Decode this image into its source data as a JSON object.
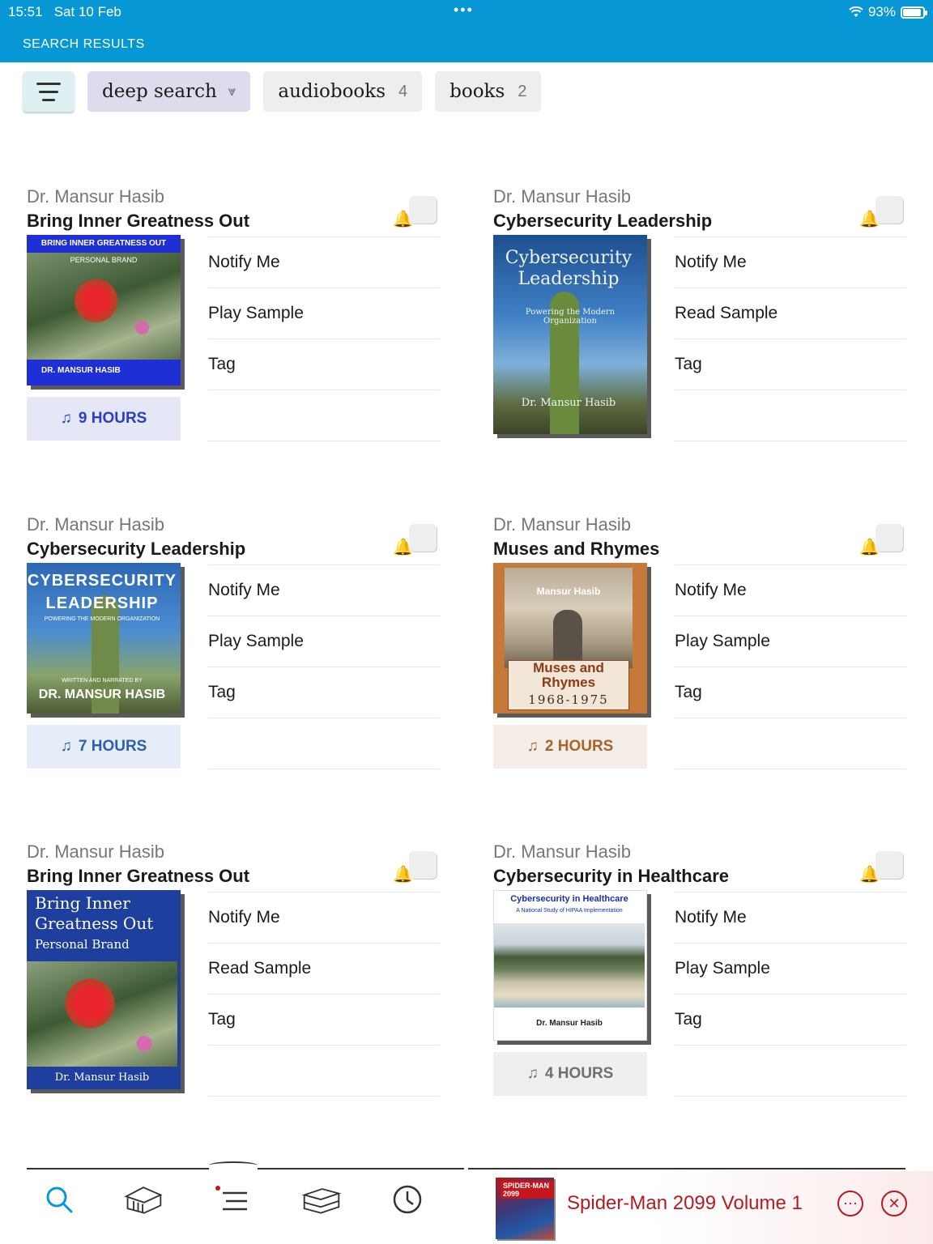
{
  "status_bar": {
    "time": "15:51",
    "date": "Sat 10 Feb",
    "battery": "93%"
  },
  "header": {
    "title": "SEARCH RESULTS"
  },
  "filters": [
    {
      "label": "deep search",
      "count": ""
    },
    {
      "label": "audiobooks",
      "count": "4"
    },
    {
      "label": "books",
      "count": "2"
    }
  ],
  "results": [
    {
      "author": "Dr. Mansur Hasib",
      "title": "Bring Inner Greatness Out",
      "cover_text": [
        "BRING INNER GREATNESS OUT",
        "PERSONAL BRAND",
        "DR. MANSUR HASIB"
      ],
      "hours": "9 HOURS",
      "hours_color": "#2a3fc1",
      "hours_bg": "#e5e7f7",
      "actions": [
        "Notify Me",
        "Play Sample",
        "Tag"
      ]
    },
    {
      "author": "Dr. Mansur Hasib",
      "title": "Cybersecurity Leadership",
      "cover_text": [
        "Cybersecurity",
        "Leadership",
        "Powering the Modern Organization",
        "Dr. Mansur Hasib"
      ],
      "hours": "",
      "actions": [
        "Notify Me",
        "Read Sample",
        "Tag"
      ]
    },
    {
      "author": "Dr. Mansur Hasib",
      "title": "Cybersecurity Leadership",
      "cover_text": [
        "CYBERSECURITY",
        "LEADERSHIP",
        "POWERING THE MODERN ORGANIZATION",
        "WRITTEN AND NARRATED BY",
        "DR. MANSUR HASIB"
      ],
      "hours": "7 HOURS",
      "hours_color": "#2f5fa8",
      "hours_bg": "#e6edf6",
      "actions": [
        "Notify Me",
        "Play Sample",
        "Tag"
      ]
    },
    {
      "author": "Dr. Mansur Hasib",
      "title": "Muses and Rhymes",
      "cover_text": [
        "Mansur Hasib",
        "Muses and",
        "Rhymes",
        "1968-1975"
      ],
      "hours": "2 HOURS",
      "hours_color": "#a8642a",
      "hours_bg": "#f5eee8",
      "actions": [
        "Notify Me",
        "Play Sample",
        "Tag"
      ]
    },
    {
      "author": "Dr. Mansur Hasib",
      "title": "Bring Inner Greatness Out",
      "cover_text": [
        "Bring Inner",
        "Greatness Out",
        "Personal Brand",
        "Dr. Mansur Hasib"
      ],
      "hours": "",
      "actions": [
        "Notify Me",
        "Read Sample",
        "Tag"
      ]
    },
    {
      "author": "Dr. Mansur Hasib",
      "title": "Cybersecurity in Healthcare",
      "cover_text": [
        "Cybersecurity in Healthcare",
        "A National Study of HIPAA Implementation",
        "Dr. Mansur Hasib"
      ],
      "hours": "4 HOURS",
      "hours_color": "#707070",
      "hours_bg": "#efefef",
      "actions": [
        "Notify Me",
        "Play Sample",
        "Tag"
      ]
    }
  ],
  "tabs": [
    "search-icon",
    "library-icon",
    "list-icon",
    "books-icon",
    "history-icon"
  ],
  "now_playing": {
    "title": "Spider-Man 2099 Volume 1",
    "cover_text": "SPIDER-MAN 2099"
  },
  "colors": {
    "header": "#0797d4",
    "accent_red": "#b51b22",
    "bell": "#f2b600"
  }
}
